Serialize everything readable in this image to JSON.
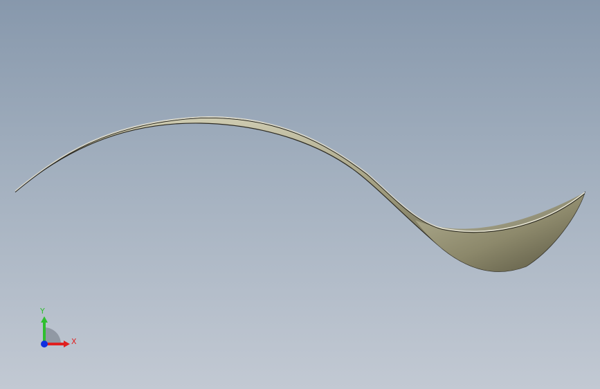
{
  "viewport": {
    "background_top": "#8798ac",
    "background_bottom": "#c2c9d3"
  },
  "model": {
    "name": "curved-blade-surface",
    "surface_color": "#aba88a",
    "edge_color": "#2c2a22"
  },
  "triad": {
    "y_label": "Y",
    "x_label": "X",
    "y_color": "#2fbf2f",
    "x_color": "#e02020",
    "z_color": "#1030e0"
  }
}
